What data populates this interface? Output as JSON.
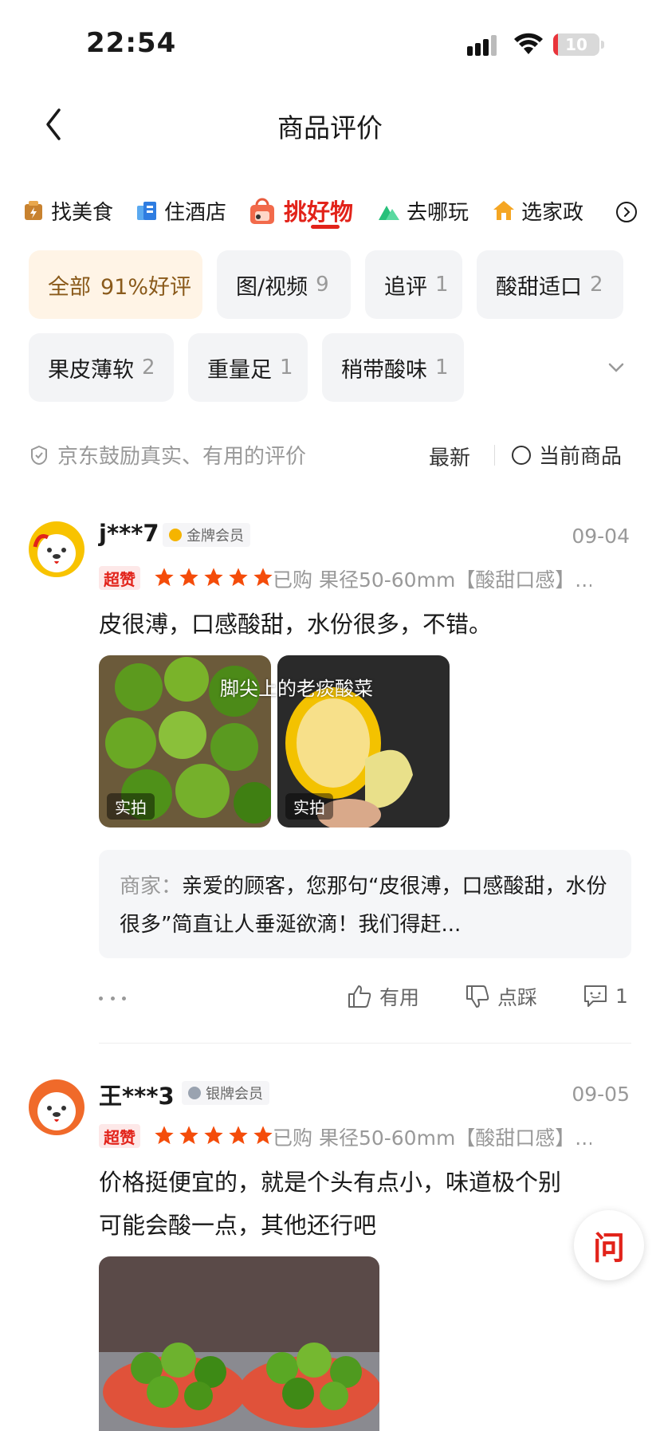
{
  "status": {
    "time": "22:54",
    "battery": "10",
    "battery_level": 0.1
  },
  "nav": {
    "title": "商品评价"
  },
  "category_tabs": [
    {
      "label": "找美食",
      "icon": "food-bag-icon"
    },
    {
      "label": "住酒店",
      "icon": "hotel-icon"
    },
    {
      "label": "挑好物",
      "icon": "shopping-bag-icon",
      "active": true
    },
    {
      "label": "去哪玩",
      "icon": "mountain-icon"
    },
    {
      "label": "选家政",
      "icon": "home-icon"
    }
  ],
  "filters": [
    {
      "label": "全部",
      "count": "91%好评",
      "active": true
    },
    {
      "label": "图/视频",
      "count": "9"
    },
    {
      "label": "追评",
      "count": "1"
    },
    {
      "label": "酸甜适口",
      "count": "2"
    },
    {
      "label": "果皮薄软",
      "count": "2"
    },
    {
      "label": "重量足",
      "count": "1"
    },
    {
      "label": "稍带酸味",
      "count": "1"
    }
  ],
  "encourage_text": "京东鼓励真实、有用的评价",
  "sort": {
    "latest": "最新",
    "current_product": "当前商品"
  },
  "reviews": [
    {
      "user": "j***7",
      "member": "金牌会员",
      "date": "09-04",
      "tag": "超赞",
      "rating": 5,
      "purchased": "已购 果径50-60mm【酸甜口感】...",
      "text": "皮很溥，口感酸甜，水份很多，不错。",
      "photo_tag": "实拍",
      "watermark": "脚尖上的老痰酸菜",
      "reply_label": "商家：",
      "reply_text": "亲爱的顾客，您那句“皮很溥，口感酸甜，水份很多”简直让人垂涎欲滴！我们得赶...",
      "useful": "有用",
      "dislike": "点踩",
      "comments": "1"
    },
    {
      "user": "王***3",
      "member": "银牌会员",
      "date": "09-05",
      "tag": "超赞",
      "rating": 5,
      "purchased": "已购 果径50-60mm【酸甜口感】...",
      "text": "价格挺便宜的，就是个头有点小，味道极个别可能会酸一点，其他还行吧"
    }
  ],
  "ask_label": "问"
}
